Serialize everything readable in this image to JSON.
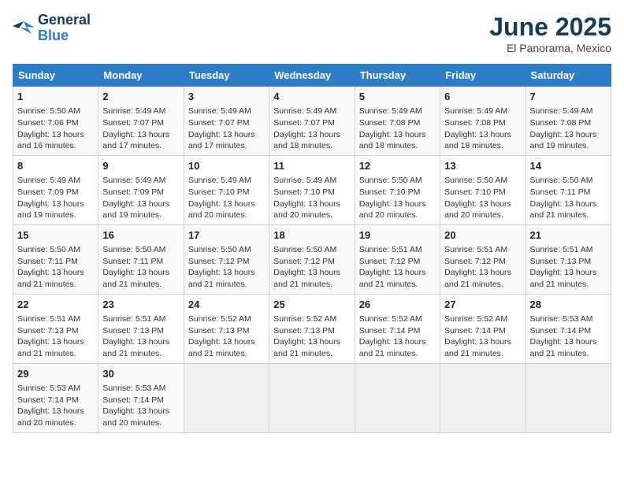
{
  "header": {
    "logo_line1": "General",
    "logo_line2": "Blue",
    "month_title": "June 2025",
    "location": "El Panorama, Mexico"
  },
  "weekdays": [
    "Sunday",
    "Monday",
    "Tuesday",
    "Wednesday",
    "Thursday",
    "Friday",
    "Saturday"
  ],
  "weeks": [
    [
      {
        "day": "1",
        "sunrise": "Sunrise: 5:50 AM",
        "sunset": "Sunset: 7:06 PM",
        "daylight": "Daylight: 13 hours and 16 minutes."
      },
      {
        "day": "2",
        "sunrise": "Sunrise: 5:49 AM",
        "sunset": "Sunset: 7:07 PM",
        "daylight": "Daylight: 13 hours and 17 minutes."
      },
      {
        "day": "3",
        "sunrise": "Sunrise: 5:49 AM",
        "sunset": "Sunset: 7:07 PM",
        "daylight": "Daylight: 13 hours and 17 minutes."
      },
      {
        "day": "4",
        "sunrise": "Sunrise: 5:49 AM",
        "sunset": "Sunset: 7:07 PM",
        "daylight": "Daylight: 13 hours and 18 minutes."
      },
      {
        "day": "5",
        "sunrise": "Sunrise: 5:49 AM",
        "sunset": "Sunset: 7:08 PM",
        "daylight": "Daylight: 13 hours and 18 minutes."
      },
      {
        "day": "6",
        "sunrise": "Sunrise: 5:49 AM",
        "sunset": "Sunset: 7:08 PM",
        "daylight": "Daylight: 13 hours and 18 minutes."
      },
      {
        "day": "7",
        "sunrise": "Sunrise: 5:49 AM",
        "sunset": "Sunset: 7:08 PM",
        "daylight": "Daylight: 13 hours and 19 minutes."
      }
    ],
    [
      {
        "day": "8",
        "sunrise": "Sunrise: 5:49 AM",
        "sunset": "Sunset: 7:09 PM",
        "daylight": "Daylight: 13 hours and 19 minutes."
      },
      {
        "day": "9",
        "sunrise": "Sunrise: 5:49 AM",
        "sunset": "Sunset: 7:09 PM",
        "daylight": "Daylight: 13 hours and 19 minutes."
      },
      {
        "day": "10",
        "sunrise": "Sunrise: 5:49 AM",
        "sunset": "Sunset: 7:10 PM",
        "daylight": "Daylight: 13 hours and 20 minutes."
      },
      {
        "day": "11",
        "sunrise": "Sunrise: 5:49 AM",
        "sunset": "Sunset: 7:10 PM",
        "daylight": "Daylight: 13 hours and 20 minutes."
      },
      {
        "day": "12",
        "sunrise": "Sunrise: 5:50 AM",
        "sunset": "Sunset: 7:10 PM",
        "daylight": "Daylight: 13 hours and 20 minutes."
      },
      {
        "day": "13",
        "sunrise": "Sunrise: 5:50 AM",
        "sunset": "Sunset: 7:10 PM",
        "daylight": "Daylight: 13 hours and 20 minutes."
      },
      {
        "day": "14",
        "sunrise": "Sunrise: 5:50 AM",
        "sunset": "Sunset: 7:11 PM",
        "daylight": "Daylight: 13 hours and 21 minutes."
      }
    ],
    [
      {
        "day": "15",
        "sunrise": "Sunrise: 5:50 AM",
        "sunset": "Sunset: 7:11 PM",
        "daylight": "Daylight: 13 hours and 21 minutes."
      },
      {
        "day": "16",
        "sunrise": "Sunrise: 5:50 AM",
        "sunset": "Sunset: 7:11 PM",
        "daylight": "Daylight: 13 hours and 21 minutes."
      },
      {
        "day": "17",
        "sunrise": "Sunrise: 5:50 AM",
        "sunset": "Sunset: 7:12 PM",
        "daylight": "Daylight: 13 hours and 21 minutes."
      },
      {
        "day": "18",
        "sunrise": "Sunrise: 5:50 AM",
        "sunset": "Sunset: 7:12 PM",
        "daylight": "Daylight: 13 hours and 21 minutes."
      },
      {
        "day": "19",
        "sunrise": "Sunrise: 5:51 AM",
        "sunset": "Sunset: 7:12 PM",
        "daylight": "Daylight: 13 hours and 21 minutes."
      },
      {
        "day": "20",
        "sunrise": "Sunrise: 5:51 AM",
        "sunset": "Sunset: 7:12 PM",
        "daylight": "Daylight: 13 hours and 21 minutes."
      },
      {
        "day": "21",
        "sunrise": "Sunrise: 5:51 AM",
        "sunset": "Sunset: 7:13 PM",
        "daylight": "Daylight: 13 hours and 21 minutes."
      }
    ],
    [
      {
        "day": "22",
        "sunrise": "Sunrise: 5:51 AM",
        "sunset": "Sunset: 7:13 PM",
        "daylight": "Daylight: 13 hours and 21 minutes."
      },
      {
        "day": "23",
        "sunrise": "Sunrise: 5:51 AM",
        "sunset": "Sunset: 7:13 PM",
        "daylight": "Daylight: 13 hours and 21 minutes."
      },
      {
        "day": "24",
        "sunrise": "Sunrise: 5:52 AM",
        "sunset": "Sunset: 7:13 PM",
        "daylight": "Daylight: 13 hours and 21 minutes."
      },
      {
        "day": "25",
        "sunrise": "Sunrise: 5:52 AM",
        "sunset": "Sunset: 7:13 PM",
        "daylight": "Daylight: 13 hours and 21 minutes."
      },
      {
        "day": "26",
        "sunrise": "Sunrise: 5:52 AM",
        "sunset": "Sunset: 7:14 PM",
        "daylight": "Daylight: 13 hours and 21 minutes."
      },
      {
        "day": "27",
        "sunrise": "Sunrise: 5:52 AM",
        "sunset": "Sunset: 7:14 PM",
        "daylight": "Daylight: 13 hours and 21 minutes."
      },
      {
        "day": "28",
        "sunrise": "Sunrise: 5:53 AM",
        "sunset": "Sunset: 7:14 PM",
        "daylight": "Daylight: 13 hours and 21 minutes."
      }
    ],
    [
      {
        "day": "29",
        "sunrise": "Sunrise: 5:53 AM",
        "sunset": "Sunset: 7:14 PM",
        "daylight": "Daylight: 13 hours and 20 minutes."
      },
      {
        "day": "30",
        "sunrise": "Sunrise: 5:53 AM",
        "sunset": "Sunset: 7:14 PM",
        "daylight": "Daylight: 13 hours and 20 minutes."
      },
      null,
      null,
      null,
      null,
      null
    ]
  ]
}
